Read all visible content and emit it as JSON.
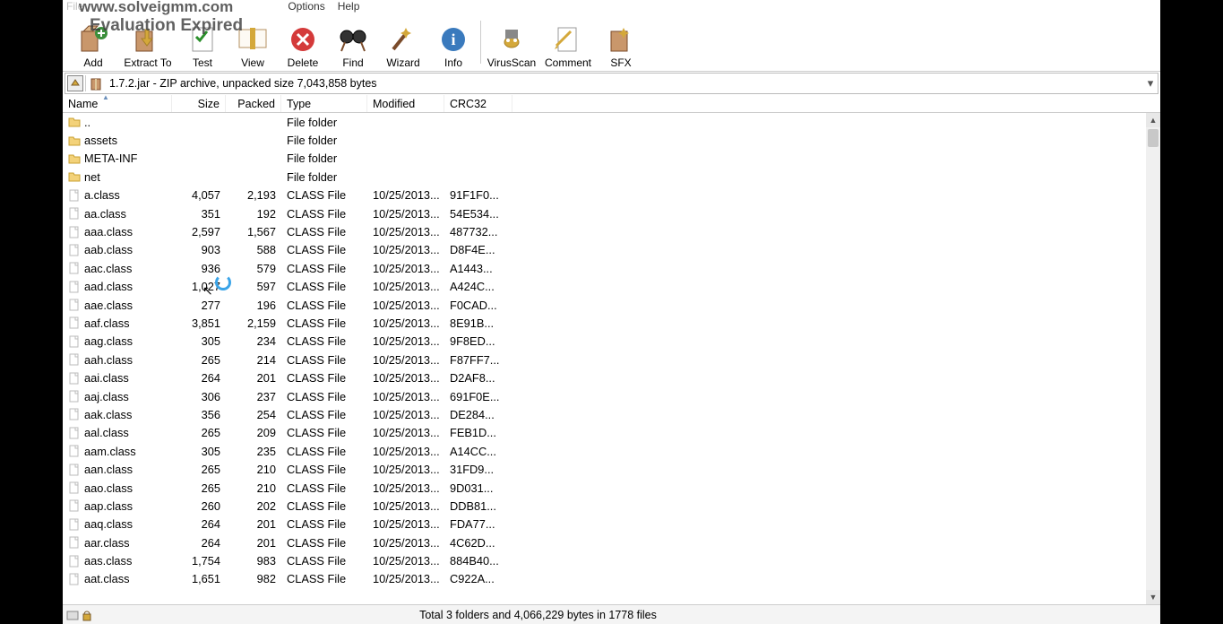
{
  "watermark": "www.solveigmm.com",
  "eval_text": "Evaluation Expired",
  "menu": {
    "file": "File",
    "options": "Options",
    "help": "Help"
  },
  "toolbar": {
    "add": "Add",
    "extract": "Extract To",
    "test": "Test",
    "view": "View",
    "delete": "Delete",
    "find": "Find",
    "wizard": "Wizard",
    "info": "Info",
    "virus": "VirusScan",
    "comment": "Comment",
    "sfx": "SFX"
  },
  "address": "1.7.2.jar - ZIP archive, unpacked size 7,043,858 bytes",
  "columns": {
    "name": "Name",
    "size": "Size",
    "packed": "Packed",
    "type": "Type",
    "modified": "Modified",
    "crc": "CRC32"
  },
  "rows": [
    {
      "name": "..",
      "size": "",
      "packed": "",
      "type": "File folder",
      "mod": "",
      "crc": "",
      "icon": "folder"
    },
    {
      "name": "assets",
      "size": "",
      "packed": "",
      "type": "File folder",
      "mod": "",
      "crc": "",
      "icon": "folder"
    },
    {
      "name": "META-INF",
      "size": "",
      "packed": "",
      "type": "File folder",
      "mod": "",
      "crc": "",
      "icon": "folder"
    },
    {
      "name": "net",
      "size": "",
      "packed": "",
      "type": "File folder",
      "mod": "",
      "crc": "",
      "icon": "folder"
    },
    {
      "name": "a.class",
      "size": "4,057",
      "packed": "2,193",
      "type": "CLASS File",
      "mod": "10/25/2013...",
      "crc": "91F1F0...",
      "icon": "file"
    },
    {
      "name": "aa.class",
      "size": "351",
      "packed": "192",
      "type": "CLASS File",
      "mod": "10/25/2013...",
      "crc": "54E534...",
      "icon": "file"
    },
    {
      "name": "aaa.class",
      "size": "2,597",
      "packed": "1,567",
      "type": "CLASS File",
      "mod": "10/25/2013...",
      "crc": "487732...",
      "icon": "file"
    },
    {
      "name": "aab.class",
      "size": "903",
      "packed": "588",
      "type": "CLASS File",
      "mod": "10/25/2013...",
      "crc": "D8F4E...",
      "icon": "file"
    },
    {
      "name": "aac.class",
      "size": "936",
      "packed": "579",
      "type": "CLASS File",
      "mod": "10/25/2013...",
      "crc": "A1443...",
      "icon": "file"
    },
    {
      "name": "aad.class",
      "size": "1,027",
      "packed": "597",
      "type": "CLASS File",
      "mod": "10/25/2013...",
      "crc": "A424C...",
      "icon": "file"
    },
    {
      "name": "aae.class",
      "size": "277",
      "packed": "196",
      "type": "CLASS File",
      "mod": "10/25/2013...",
      "crc": "F0CAD...",
      "icon": "file"
    },
    {
      "name": "aaf.class",
      "size": "3,851",
      "packed": "2,159",
      "type": "CLASS File",
      "mod": "10/25/2013...",
      "crc": "8E91B...",
      "icon": "file"
    },
    {
      "name": "aag.class",
      "size": "305",
      "packed": "234",
      "type": "CLASS File",
      "mod": "10/25/2013...",
      "crc": "9F8ED...",
      "icon": "file"
    },
    {
      "name": "aah.class",
      "size": "265",
      "packed": "214",
      "type": "CLASS File",
      "mod": "10/25/2013...",
      "crc": "F87FF7...",
      "icon": "file"
    },
    {
      "name": "aai.class",
      "size": "264",
      "packed": "201",
      "type": "CLASS File",
      "mod": "10/25/2013...",
      "crc": "D2AF8...",
      "icon": "file"
    },
    {
      "name": "aaj.class",
      "size": "306",
      "packed": "237",
      "type": "CLASS File",
      "mod": "10/25/2013...",
      "crc": "691F0E...",
      "icon": "file"
    },
    {
      "name": "aak.class",
      "size": "356",
      "packed": "254",
      "type": "CLASS File",
      "mod": "10/25/2013...",
      "crc": "DE284...",
      "icon": "file"
    },
    {
      "name": "aal.class",
      "size": "265",
      "packed": "209",
      "type": "CLASS File",
      "mod": "10/25/2013...",
      "crc": "FEB1D...",
      "icon": "file"
    },
    {
      "name": "aam.class",
      "size": "305",
      "packed": "235",
      "type": "CLASS File",
      "mod": "10/25/2013...",
      "crc": "A14CC...",
      "icon": "file"
    },
    {
      "name": "aan.class",
      "size": "265",
      "packed": "210",
      "type": "CLASS File",
      "mod": "10/25/2013...",
      "crc": "31FD9...",
      "icon": "file"
    },
    {
      "name": "aao.class",
      "size": "265",
      "packed": "210",
      "type": "CLASS File",
      "mod": "10/25/2013...",
      "crc": "9D031...",
      "icon": "file"
    },
    {
      "name": "aap.class",
      "size": "260",
      "packed": "202",
      "type": "CLASS File",
      "mod": "10/25/2013...",
      "crc": "DDB81...",
      "icon": "file"
    },
    {
      "name": "aaq.class",
      "size": "264",
      "packed": "201",
      "type": "CLASS File",
      "mod": "10/25/2013...",
      "crc": "FDA77...",
      "icon": "file"
    },
    {
      "name": "aar.class",
      "size": "264",
      "packed": "201",
      "type": "CLASS File",
      "mod": "10/25/2013...",
      "crc": "4C62D...",
      "icon": "file"
    },
    {
      "name": "aas.class",
      "size": "1,754",
      "packed": "983",
      "type": "CLASS File",
      "mod": "10/25/2013...",
      "crc": "884B40...",
      "icon": "file"
    },
    {
      "name": "aat.class",
      "size": "1,651",
      "packed": "982",
      "type": "CLASS File",
      "mod": "10/25/2013...",
      "crc": "C922A...",
      "icon": "file"
    }
  ],
  "status": "Total 3 folders and 4,066,229 bytes in 1778 files"
}
